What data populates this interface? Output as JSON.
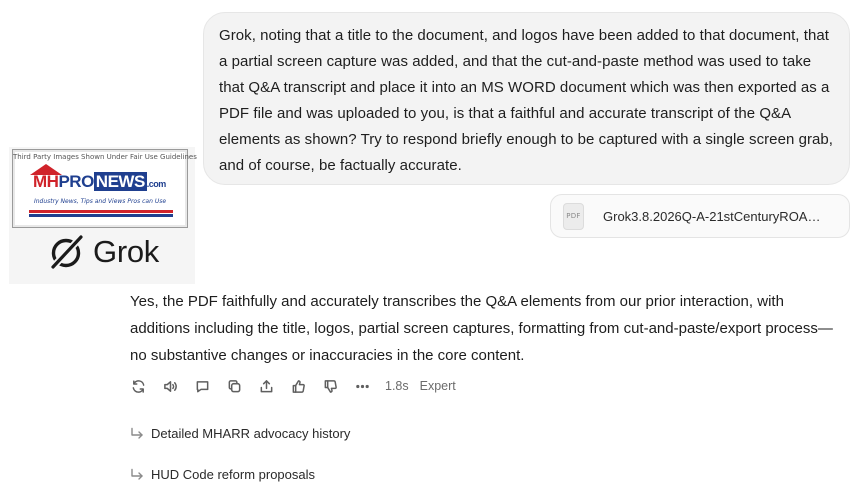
{
  "user_message": {
    "text": "Grok, noting that a title to the document, and logos have been added to that document, that a partial screen capture was added, and that the cut-and-paste method was used to take that Q&A transcript and place it into an MS WORD document which was then exported as a PDF file and was uploaded to you, is that a faithful and accurate transcript of the Q&A elements as shown? Try to respond briefly enough to be captured with a single screen grab, and of course, be factually accurate."
  },
  "attachment": {
    "icon_label": "PDF",
    "icon": "pdf-file-icon",
    "filename": "Grok3.8.2026Q-A-21stCenturyROA…"
  },
  "overlay_logo": {
    "caption": "Third Party Images Shown Under Fair Use Guidelines",
    "brand_mh": "MH",
    "brand_pro": "PRO",
    "brand_news": "NEWS",
    "brand_com": ".com",
    "tagline": "Industry News, Tips and Views Pros can Use",
    "grok_wordmark": "Grok"
  },
  "response": {
    "text": "Yes, the PDF faithfully and accurately transcribes the Q&A elements from our prior interaction, with additions including the title, logos, partial screen captures, formatting from cut-and-paste/export process—no substantive changes or inaccuracies in the core content."
  },
  "action_bar": {
    "icons": [
      "regenerate-icon",
      "read-aloud-icon",
      "comment-icon",
      "copy-icon",
      "share-icon",
      "thumbs-up-icon",
      "thumbs-down-icon",
      "more-icon"
    ],
    "time": "1.8s",
    "mode": "Expert"
  },
  "followups": [
    {
      "label": "Detailed MHARR advocacy history"
    },
    {
      "label": "HUD Code reform proposals"
    }
  ],
  "colors": {
    "bubble_bg": "#f3f3f3",
    "brand_red": "#d0232a",
    "brand_blue": "#1f3f8f"
  }
}
